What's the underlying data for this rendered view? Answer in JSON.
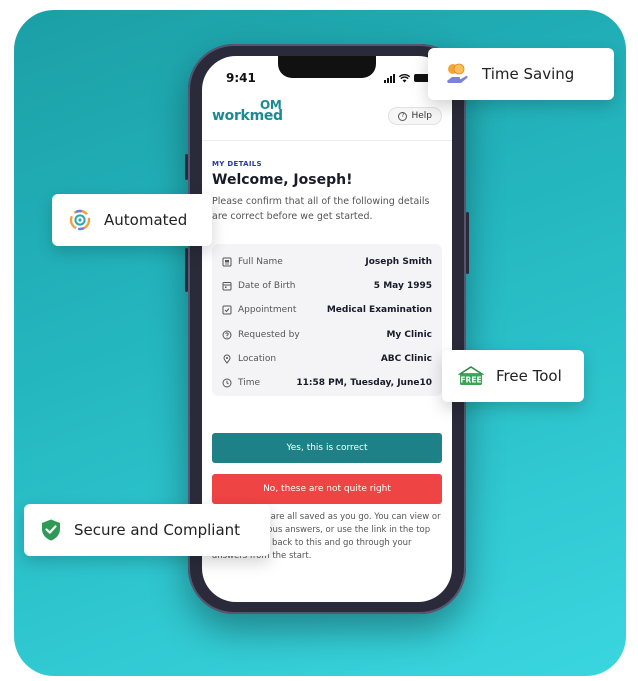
{
  "badges": {
    "time_saving": {
      "label": "Time Saving",
      "icon": "coins-hand-icon"
    },
    "automated": {
      "label": "Automated",
      "icon": "automation-gear-icon"
    },
    "free_tool": {
      "label": "Free Tool",
      "icon": "free-tag-icon",
      "tag_text": "FREE"
    },
    "secure": {
      "label": "Secure and Compliant",
      "icon": "shield-check-icon"
    }
  },
  "phone": {
    "status_time": "9:41",
    "logo": "workmed",
    "logo_mark": "OM",
    "help_label": "Help",
    "section_label": "MY DETAILS",
    "welcome": "Welcome, Joseph!",
    "intro": "Please confirm that all of the following details are correct before we get started.",
    "details": [
      {
        "label": "Full Name",
        "value": "Joseph Smith",
        "icon": "id-card-icon"
      },
      {
        "label": "Date of Birth",
        "value": "5 May 1995",
        "icon": "calendar-icon"
      },
      {
        "label": "Appointment",
        "value": "Medical Examination",
        "icon": "checkbox-icon"
      },
      {
        "label": "Requested by",
        "value": "My Clinic",
        "icon": "question-circle-icon"
      },
      {
        "label": "Location",
        "value": "ABC Clinic",
        "icon": "location-pin-icon"
      },
      {
        "label": "Time",
        "value": "11:58 PM, Tuesday, June10",
        "icon": "clock-icon"
      }
    ],
    "confirm_label": "Yes, this is correct",
    "reject_label": "No, these are not quite right",
    "footer_note": "Your answers are all saved as you go. You can view or change previous answers, or use the link in the top right to come back to this and go through your answers from the start."
  },
  "colors": {
    "background_gradient_start": "#1c9fa6",
    "background_gradient_end": "#3ad6df",
    "confirm_button": "#1d8187",
    "reject_button": "#ee4444",
    "brand": "#1c8a92"
  }
}
